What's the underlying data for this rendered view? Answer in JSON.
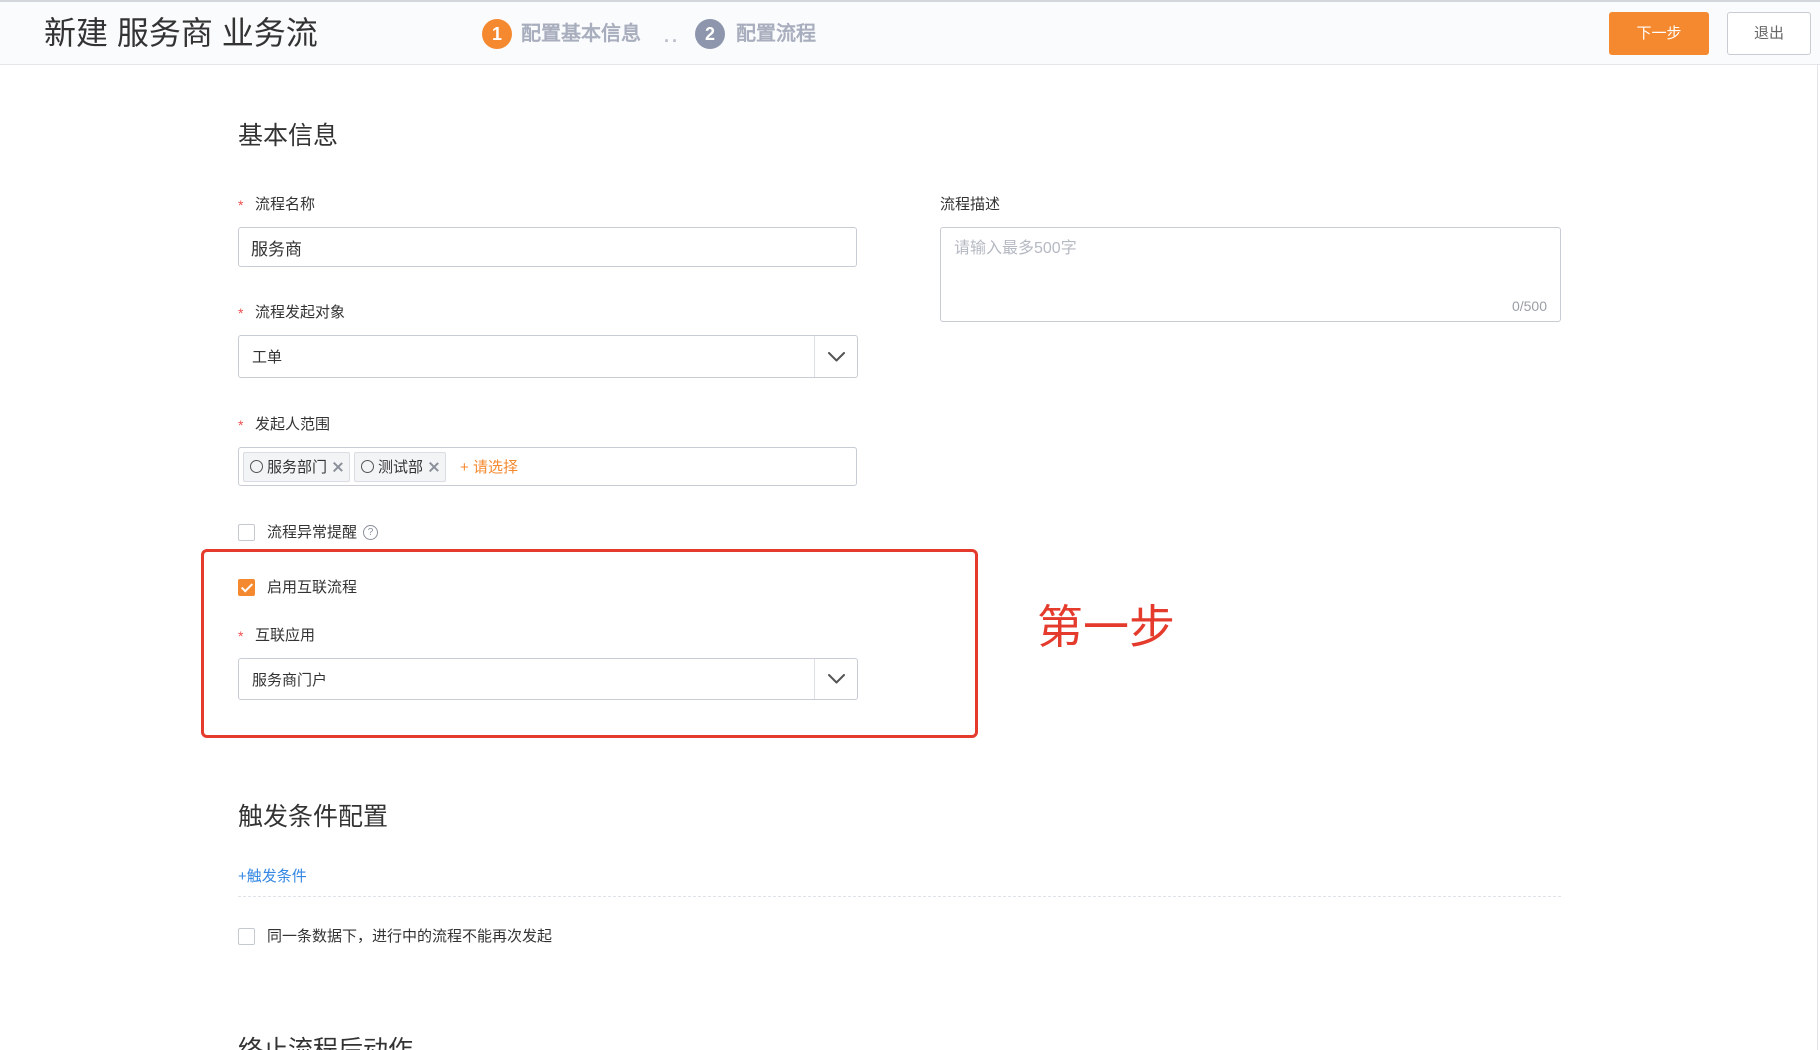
{
  "header": {
    "title": "新建 服务商 业务流",
    "steps": [
      {
        "number": "1",
        "label": "配置基本信息",
        "active": true
      },
      {
        "number": "2",
        "label": "配置流程",
        "active": false
      }
    ],
    "step_separator": "..",
    "next_label": "下一步",
    "exit_label": "退出"
  },
  "basic_info": {
    "heading": "基本信息",
    "required_mark": "*",
    "flow_name": {
      "label": "流程名称",
      "value": "服务商"
    },
    "flow_description": {
      "label": "流程描述",
      "placeholder": "请输入最多500字",
      "counter": "0/500"
    },
    "initiator_object": {
      "label": "流程发起对象",
      "selected": "工单"
    },
    "initiator_scope": {
      "label": "发起人范围",
      "tags": [
        "服务部门",
        "测试部"
      ],
      "add_label": "+ 请选择"
    },
    "exception_alert": {
      "label": "流程异常提醒",
      "checked": false,
      "help_glyph": "?"
    },
    "interconnect_flow": {
      "label": "启用互联流程",
      "checked": true
    },
    "interconnect_app": {
      "label": "互联应用",
      "selected": "服务商门户"
    }
  },
  "annotation": {
    "text": "第一步"
  },
  "trigger_config": {
    "heading": "触发条件配置",
    "add_condition_label": "+触发条件",
    "no_repeat_launch": {
      "label": "同一条数据下，进行中的流程不能再次发起",
      "checked": false
    }
  },
  "post_termination": {
    "heading": "终止流程后动作"
  },
  "colors": {
    "accent": "#f5892f",
    "step_inactive": "#8d96ad",
    "annotation": "#e53b2d",
    "link": "#3487e2",
    "required": "#ef4f4f"
  },
  "icons": {
    "dropdown": "chevron-down-icon",
    "tag_type": "circle-icon",
    "tag_remove": "close-icon",
    "help": "question-circle-icon",
    "checkbox_checked": "check-icon"
  }
}
